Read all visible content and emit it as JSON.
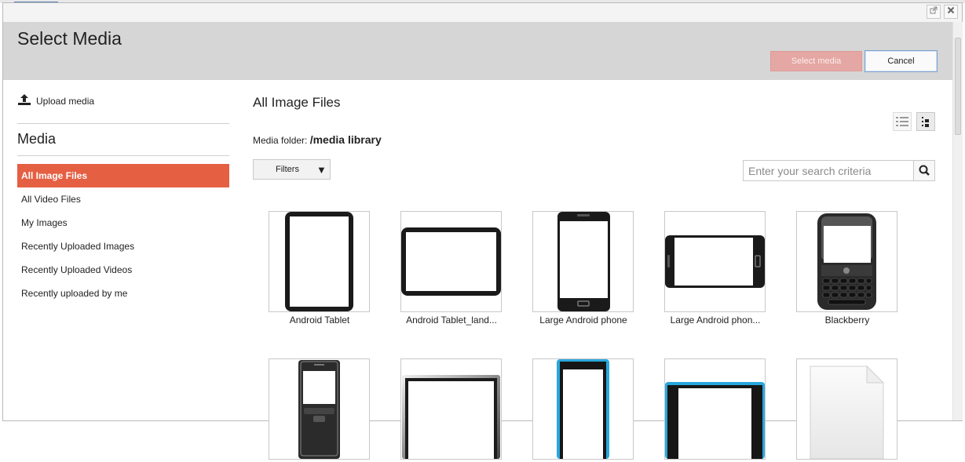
{
  "dialog": {
    "title": "Select Media",
    "select_label": "Select media",
    "cancel_label": "Cancel",
    "accent_color": "#e55f43"
  },
  "sidebar": {
    "upload_label": "Upload media",
    "section_title": "Media",
    "items": [
      {
        "label": "All Image Files",
        "active": true
      },
      {
        "label": "All Video Files"
      },
      {
        "label": "My Images"
      },
      {
        "label": "Recently Uploaded Images"
      },
      {
        "label": "Recently Uploaded Videos"
      },
      {
        "label": "Recently uploaded by me"
      }
    ]
  },
  "main": {
    "heading": "All Image Files",
    "folder_label": "Media folder:",
    "folder_path": "/media library",
    "filters_label": "Filters",
    "search_placeholder": "Enter your search criteria",
    "items": [
      {
        "caption": "Android Tablet",
        "icon": "tablet-portrait-icon"
      },
      {
        "caption": "Android Tablet_land...",
        "icon": "tablet-landscape-icon"
      },
      {
        "caption": "Large Android phone",
        "icon": "phone-portrait-icon"
      },
      {
        "caption": "Large Android phon...",
        "icon": "phone-landscape-icon"
      },
      {
        "caption": "Blackberry",
        "icon": "blackberry-icon"
      },
      {
        "caption": "",
        "icon": "feature-phone-icon"
      },
      {
        "caption": "",
        "icon": "silver-tablet-icon"
      },
      {
        "caption": "",
        "icon": "blue-phone-icon"
      },
      {
        "caption": "",
        "icon": "blue-phone-landscape-icon"
      },
      {
        "caption": "",
        "icon": "blank-document-icon"
      }
    ]
  }
}
